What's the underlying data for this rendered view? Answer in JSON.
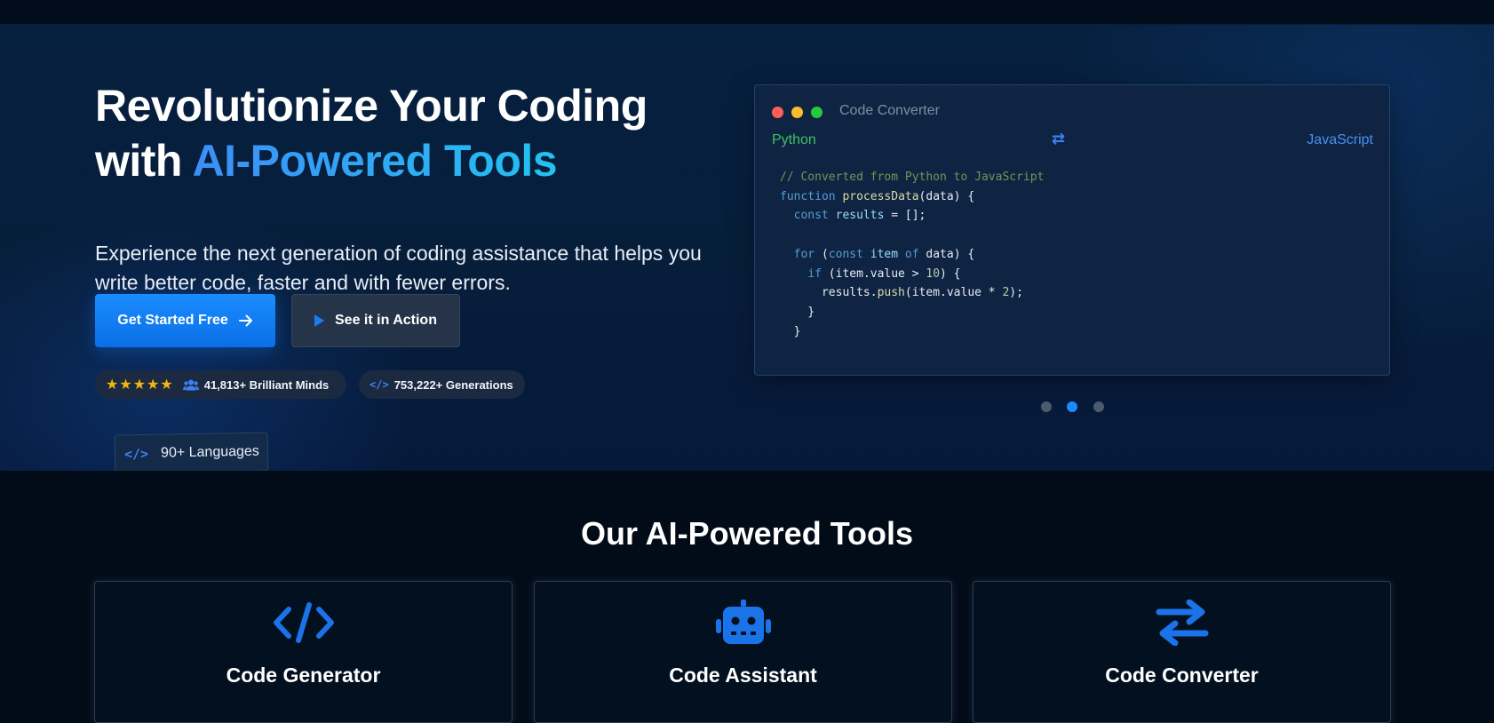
{
  "hero": {
    "title_line1": "Revolutionize Your Coding",
    "title_line2_prefix": "with ",
    "title_line2_accent": "AI-Powered Tools",
    "subtitle_line1": "Experience the next generation of coding assistance that helps you",
    "subtitle_line2": "write better code, faster and with fewer errors.",
    "primary_button": "Get Started Free",
    "secondary_button": "See it in Action",
    "stats": {
      "stars": "★★★★★",
      "users": "41,813+ Brilliant Minds",
      "generations": "753,222+ Generations"
    },
    "languages_badge": "90+ Languages"
  },
  "converter": {
    "title": "Code Converter",
    "from_lang": "Python",
    "to_lang": "JavaScript",
    "swap_glyph": "⇄",
    "code_lines": [
      "// Converted from Python to JavaScript",
      "function processData(data) {",
      "  const results = [];",
      "",
      "  for (const item of data) {",
      "    if (item.value > 10) {",
      "      results.push(item.value * 2);",
      "    }",
      "  }"
    ]
  },
  "carousel": {
    "slide_count": 3,
    "active_index": 1
  },
  "tools": {
    "section_title": "Our AI-Powered Tools",
    "items": [
      {
        "label": "Code Generator",
        "icon": "code-brackets-icon"
      },
      {
        "label": "Code Assistant",
        "icon": "robot-icon"
      },
      {
        "label": "Code Converter",
        "icon": "swap-arrows-icon"
      }
    ]
  },
  "colors": {
    "accent": "#1a8cff",
    "background": "#020b18",
    "hero_background": "#071e3b",
    "python_green": "#3ec160",
    "javascript_blue": "#4a90f0"
  }
}
